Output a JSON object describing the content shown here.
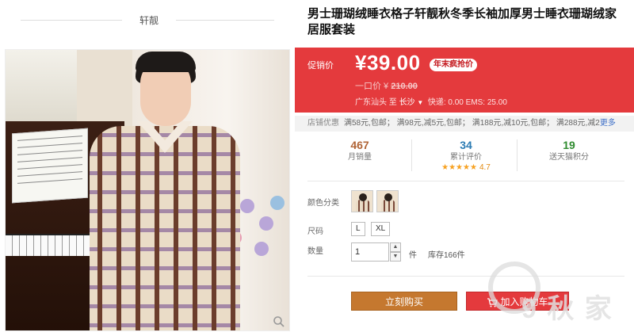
{
  "shop": {
    "name": "轩靓"
  },
  "product": {
    "title": "男士珊瑚绒睡衣格子轩靓秋冬季长袖加厚男士睡衣珊瑚绒家居服套装"
  },
  "price": {
    "label": "促销价",
    "current": "¥39.00",
    "badge": "年末疯抢价",
    "original_label": "一口价 ¥",
    "original": "210.00"
  },
  "shipping": {
    "from": "广东汕头",
    "to_word": "至",
    "to": "长沙",
    "fees": "快递: 0.00 EMS: 25.00"
  },
  "promotion": {
    "label": "店铺优惠",
    "text": "满58元,包邮； 满98元,减5元,包邮； 满188元,减10元,包邮； 满288元,减2",
    "more": "更多"
  },
  "stats": [
    {
      "value": "467",
      "caption": "月销量"
    },
    {
      "value": "34",
      "caption": "累计评价",
      "stars": "★★★★★",
      "rating": "4.7"
    },
    {
      "value": "19",
      "caption": "送天猫积分"
    }
  ],
  "options": {
    "color_label": "颜色分类",
    "size_label": "尺码",
    "sizes": [
      "L",
      "XL"
    ],
    "qty_label": "数量",
    "qty_value": "1",
    "qty_unit": "件",
    "stock": "库存166件"
  },
  "actions": {
    "buy": "立刻购买",
    "cart": "加入购物车"
  },
  "watermark": {
    "text": "9 秋 家"
  },
  "colors": {
    "accent": "#e43a3d",
    "buy": "#c5782f",
    "link": "#3c6ec7"
  }
}
